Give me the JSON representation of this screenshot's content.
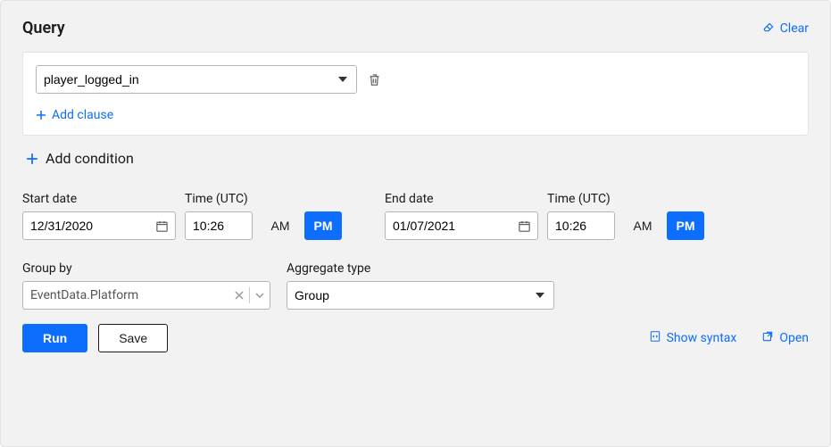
{
  "header": {
    "title": "Query",
    "clear_label": "Clear"
  },
  "conditions": {
    "event_value": "player_logged_in",
    "add_clause_label": "Add clause",
    "add_condition_label": "Add condition"
  },
  "start": {
    "date_label": "Start date",
    "date_value": "12/31/2020",
    "time_label": "Time (UTC)",
    "time_value": "10:26",
    "am_label": "AM",
    "pm_label": "PM",
    "active": "PM"
  },
  "end": {
    "date_label": "End date",
    "date_value": "01/07/2021",
    "time_label": "Time (UTC)",
    "time_value": "10:26",
    "am_label": "AM",
    "pm_label": "PM",
    "active": "PM"
  },
  "groupby": {
    "label": "Group by",
    "value": "EventData.Platform"
  },
  "aggregate": {
    "label": "Aggregate type",
    "value": "Group"
  },
  "footer": {
    "run_label": "Run",
    "save_label": "Save",
    "show_syntax_label": "Show syntax",
    "open_label": "Open"
  }
}
